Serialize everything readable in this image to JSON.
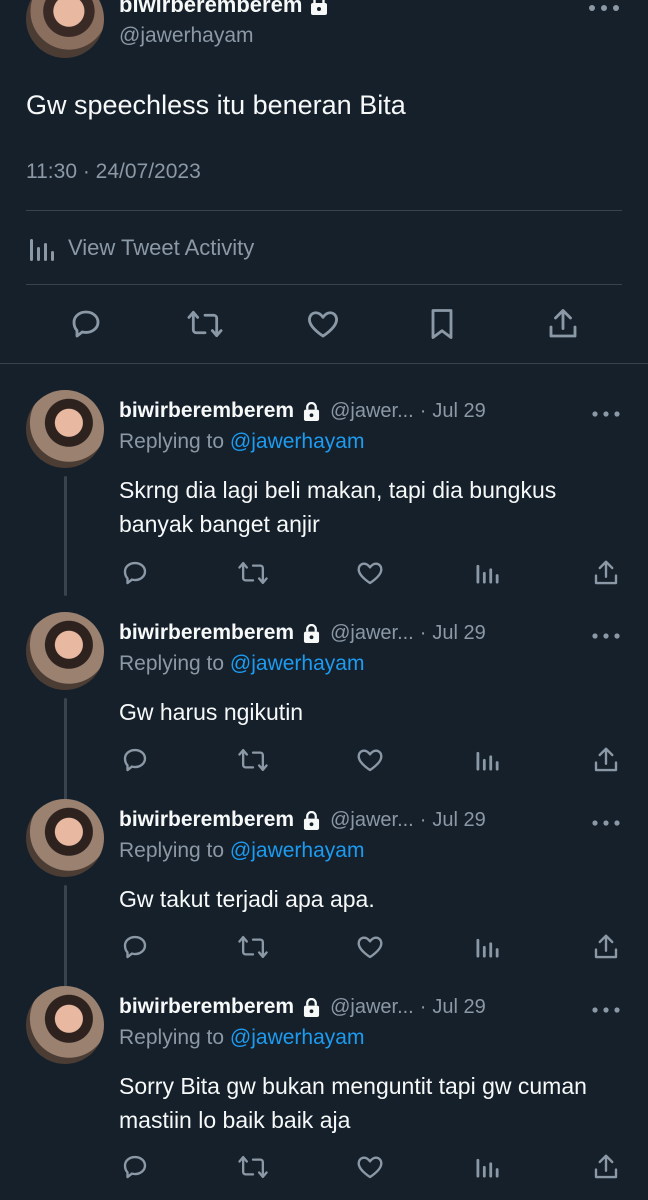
{
  "main_tweet": {
    "display_name": "biwirberemberem",
    "handle": "@jawerhayam",
    "text": "Gw speechless itu beneran Bita",
    "timestamp": "11:30 · 24/07/2023",
    "activity_label": "View Tweet Activity",
    "icons": [
      "lock-icon",
      "more-icon",
      "analytics-icon",
      "reply-icon",
      "retweet-icon",
      "like-icon",
      "bookmark-icon",
      "share-icon"
    ]
  },
  "replies": [
    {
      "display_name": "biwirberemberem",
      "handle": "@jawer...",
      "dot": "·",
      "date": "Jul 29",
      "replying_prefix": "Replying to",
      "replying_to": "@jawerhayam",
      "text": "Skrng dia lagi beli makan, tapi dia bungkus banyak banget anjir"
    },
    {
      "display_name": "biwirberemberem",
      "handle": "@jawer...",
      "dot": "·",
      "date": "Jul 29",
      "replying_prefix": "Replying to",
      "replying_to": "@jawerhayam",
      "text": "Gw harus ngikutin"
    },
    {
      "display_name": "biwirberemberem",
      "handle": "@jawer...",
      "dot": "·",
      "date": "Jul 29",
      "replying_prefix": "Replying to",
      "replying_to": "@jawerhayam",
      "text": "Gw takut terjadi apa apa."
    },
    {
      "display_name": "biwirberemberem",
      "handle": "@jawer...",
      "dot": "·",
      "date": "Jul 29",
      "replying_prefix": "Replying to",
      "replying_to": "@jawerhayam",
      "text": "Sorry Bita gw bukan menguntit tapi gw cuman mastiin lo baik baik aja"
    }
  ],
  "colors": {
    "background": "#15202b",
    "text": "#f7f9f9",
    "muted": "#8b98a5",
    "link": "#1d9bf0",
    "divider": "#38444d"
  }
}
